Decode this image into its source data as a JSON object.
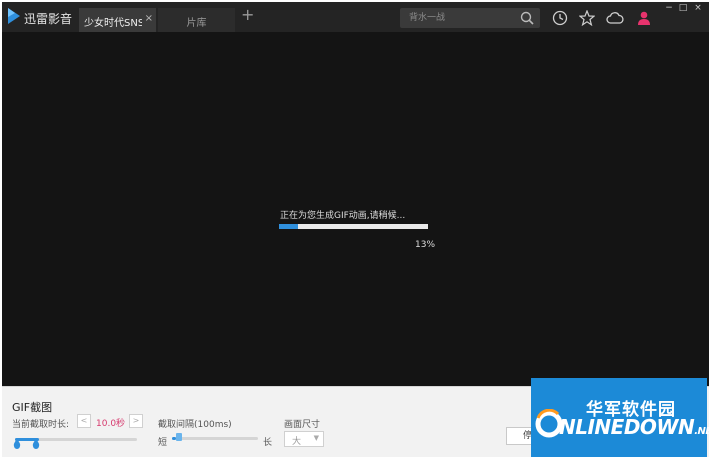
{
  "app": {
    "name": "迅雷影音",
    "accent": "#2f8fdc",
    "logo_color": "#2f8fdc"
  },
  "tabs": [
    {
      "label": "少女时代SNSD",
      "active": true,
      "close": "×"
    },
    {
      "label": "片库",
      "active": false
    }
  ],
  "new_tab_symbol": "+",
  "search": {
    "placeholder": "背水一战",
    "icon": "search-icon"
  },
  "toolbar_icons": [
    "history-clock-icon",
    "star-icon",
    "cloud-icon",
    "user-icon"
  ],
  "window_controls": {
    "minimize": "−",
    "maximize": "□",
    "close": "×"
  },
  "progress": {
    "message": "正在为您生成GIF动画,请稍候...",
    "percent": 13,
    "percent_label": "13%"
  },
  "gif_panel": {
    "title": "GIF截图",
    "duration_label": "当前截取时长:",
    "duration_value": "10.0秒",
    "decrease": "<",
    "increase": ">",
    "interval_label": "截取间隔(100ms)",
    "interval_short": "短",
    "interval_long": "长",
    "interval_level": 0.05,
    "size_label": "画面尺寸",
    "size_value": "大",
    "stop_label": "停止"
  },
  "watermark": {
    "cn": "华军软件园",
    "en": "NLINEDOWN",
    "suffix": ".NET"
  }
}
